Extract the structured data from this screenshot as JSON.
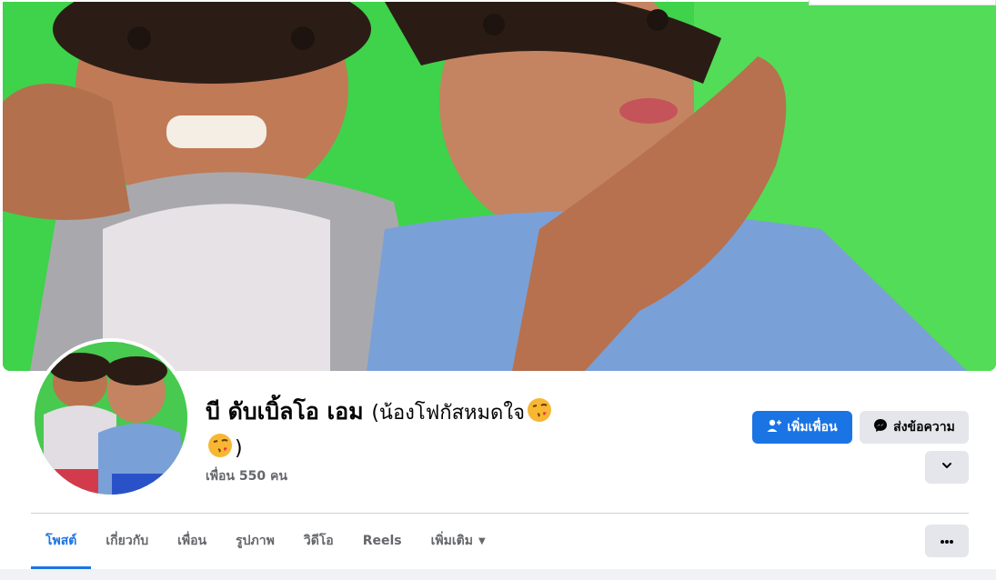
{
  "profile": {
    "name": "บี ดับเบิ้ลโอ เอม",
    "nickname_open": "(น้องโฟกัสหมดใจ",
    "nickname_close": ")",
    "friends_text": "เพื่อน 550 คน"
  },
  "actions": {
    "add_friend_label": "เพิ่มเพื่อน",
    "message_label": "ส่งข้อความ"
  },
  "tabs": [
    {
      "label": "โพสต์",
      "active": true
    },
    {
      "label": "เกี่ยวกับ",
      "active": false
    },
    {
      "label": "เพื่อน",
      "active": false
    },
    {
      "label": "รูปภาพ",
      "active": false
    },
    {
      "label": "วิดีโอ",
      "active": false
    },
    {
      "label": "Reels",
      "active": false
    },
    {
      "label": "เพิ่มเติม",
      "active": false
    }
  ],
  "colors": {
    "accent": "#1b74e4",
    "secondary_button": "#e4e6eb",
    "text_primary": "#050505",
    "text_secondary": "#65676b",
    "cover_background": "#3fd24b"
  },
  "icons": {
    "emoji": "kissing-face-with-heart-emoji",
    "add_friend": "person-add-icon",
    "message": "messenger-icon",
    "chevron": "chevron-down-icon",
    "more": "more-horizontal-icon",
    "dropdown": "caret-down-icon"
  }
}
